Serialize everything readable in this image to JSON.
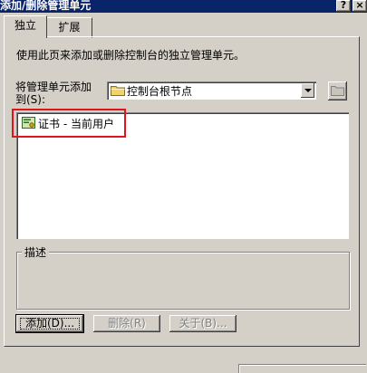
{
  "window": {
    "title": "添加/删除管理单元",
    "help_button": "?",
    "close_button": "×"
  },
  "tabs": [
    {
      "label": "独立",
      "active": true
    },
    {
      "label": "扩展",
      "active": false
    }
  ],
  "instructions": "使用此页来添加或删除控制台的独立管理单元。",
  "add_to": {
    "label_line1": "将管理单元添加",
    "label_line2": "到(S):",
    "selected": "控制台根节点",
    "icon": "folder-icon"
  },
  "snapins": [
    {
      "label": "证书 - 当前用户",
      "icon": "certificate-icon"
    }
  ],
  "description": {
    "label": "描述",
    "text": ""
  },
  "buttons": {
    "add": "添加(D)...",
    "remove": "删除(R)",
    "about": "关于(B)..."
  },
  "colors": {
    "titlebar": "#0a246a",
    "face": "#d4d0c8",
    "highlight_box": "#e0141e"
  }
}
